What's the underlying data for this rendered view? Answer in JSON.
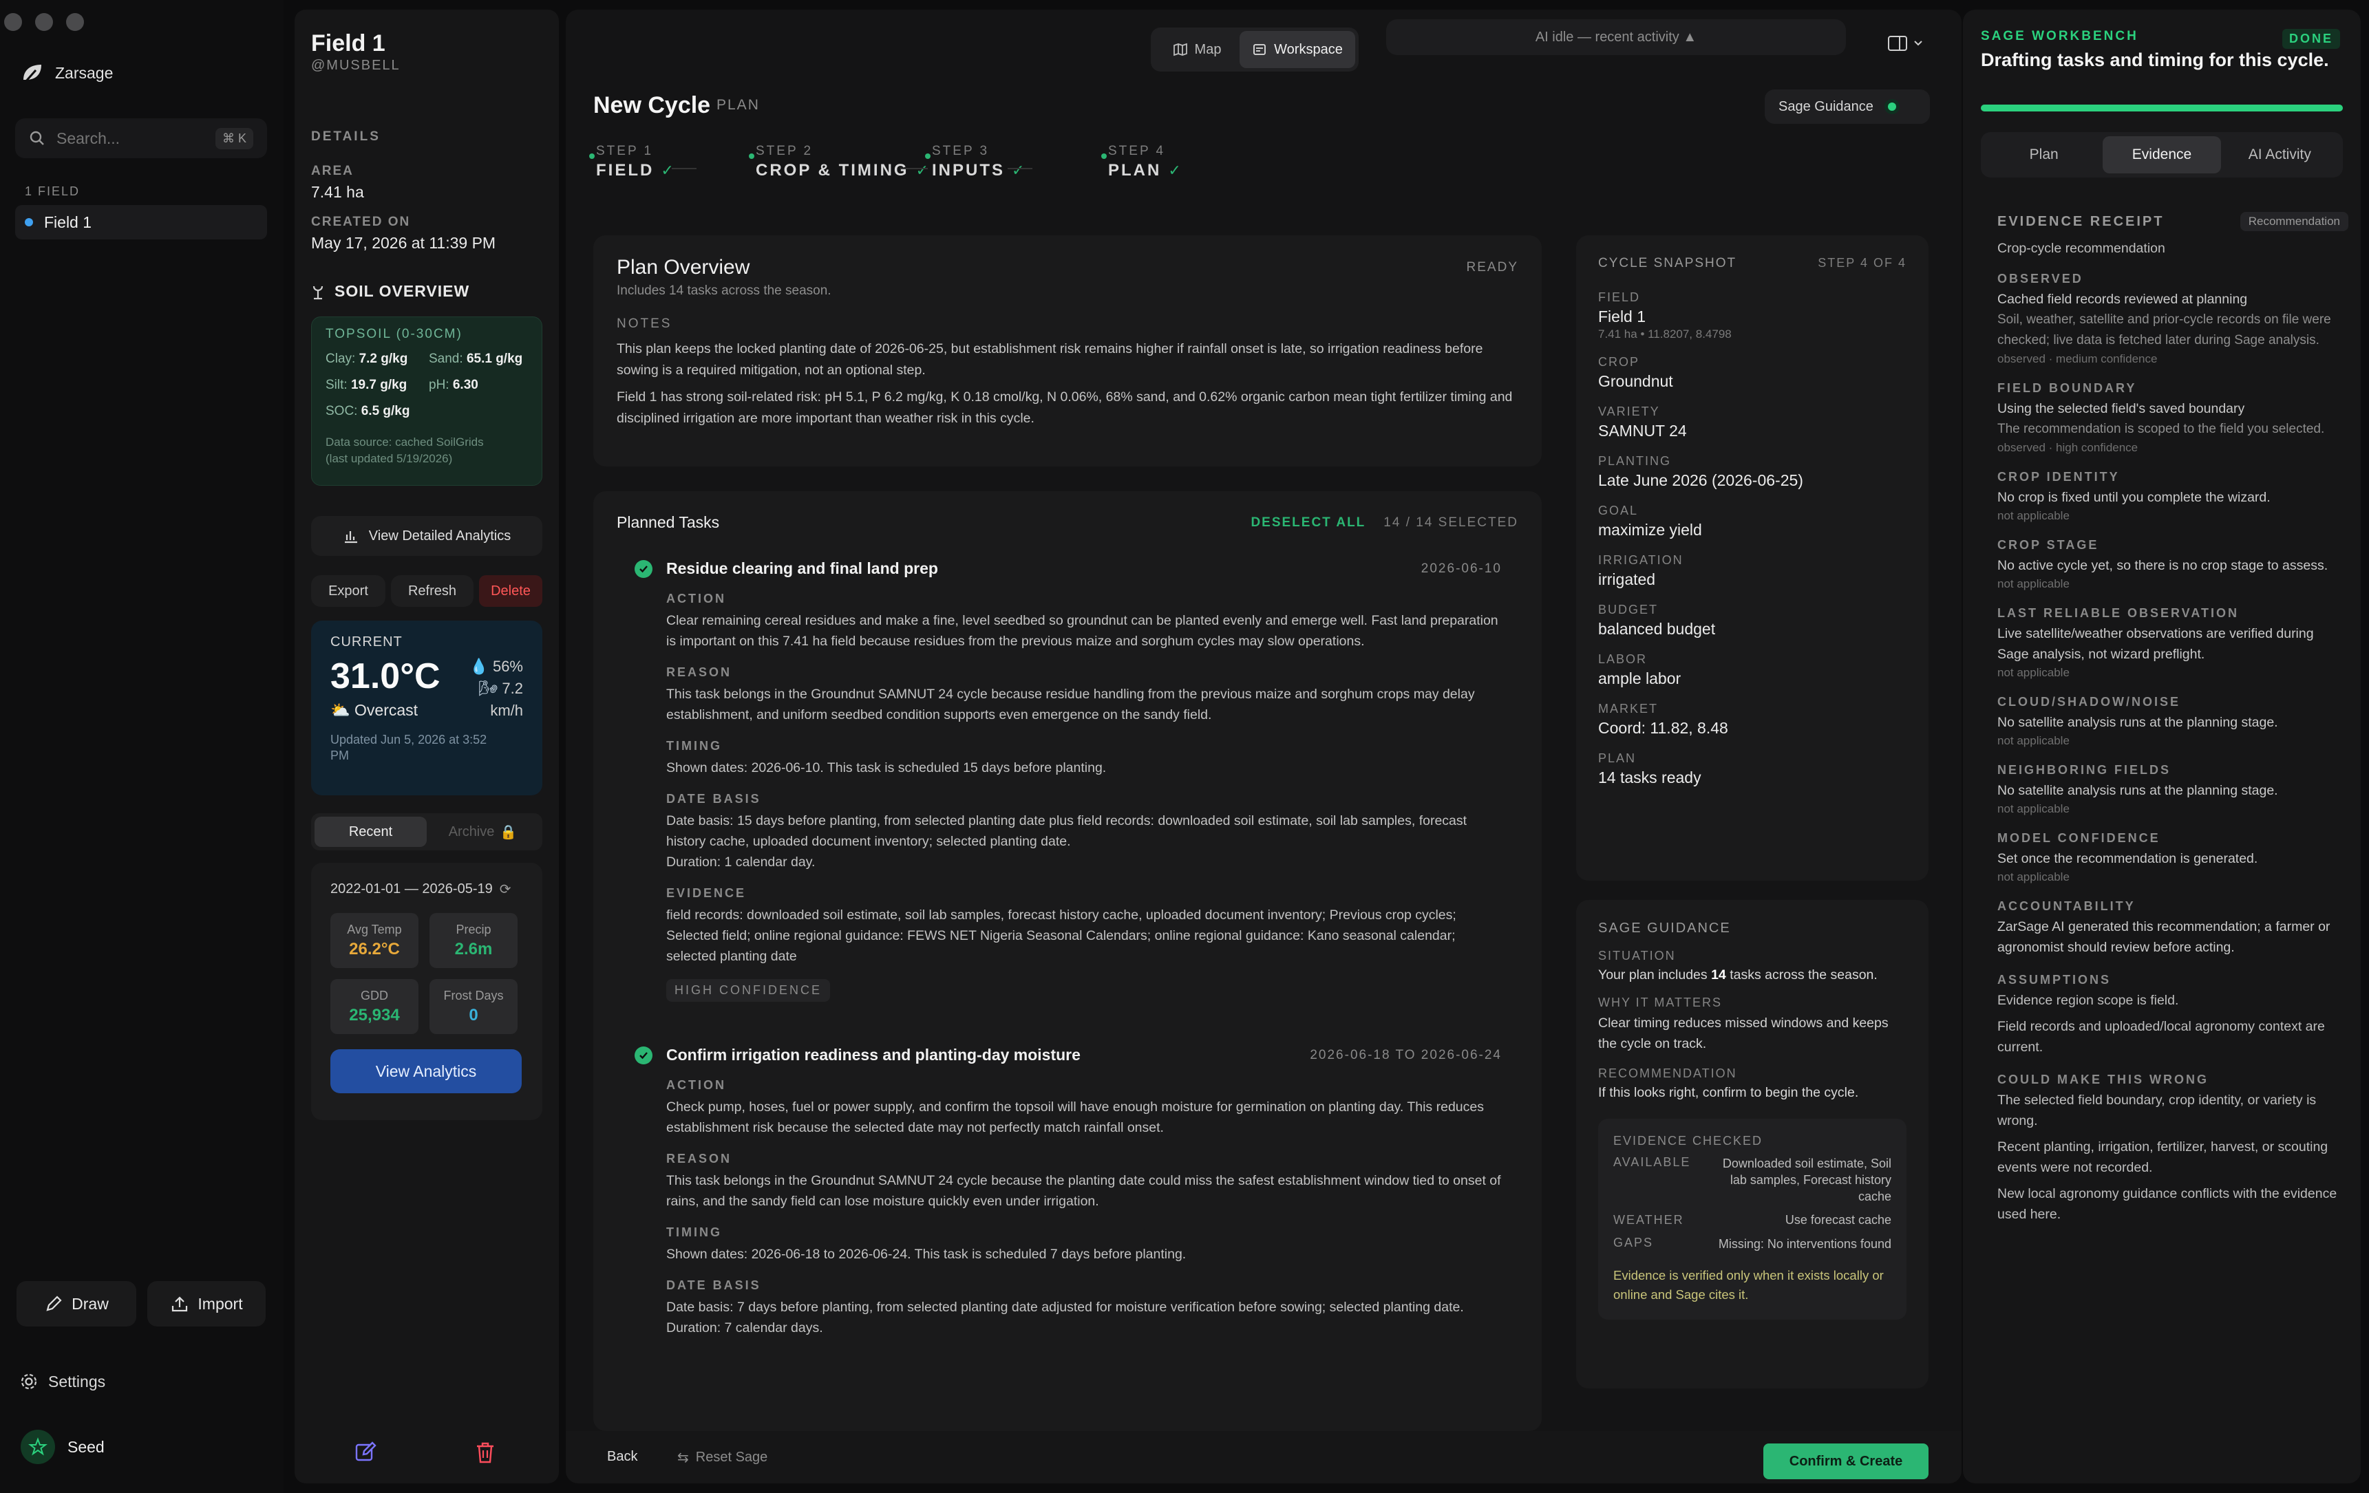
{
  "app": {
    "name": "Zarsage"
  },
  "nav": {
    "search_placeholder": "Search...",
    "shortcut": "⌘ K",
    "section": "1 FIELD",
    "field": "Field 1",
    "draw": "Draw",
    "import": "Import",
    "settings": "Settings",
    "user": "Seed"
  },
  "field": {
    "title": "Field 1",
    "user": "@MUSBELL",
    "details": "DETAILS",
    "area_label": "AREA",
    "area": "7.41 ha",
    "created_label": "CREATED ON",
    "created": "May 17, 2026 at 11:39 PM",
    "soil_title": "SOIL OVERVIEW",
    "topsoil": "TOPSOIL (0-30CM)",
    "clay_k": "Clay:",
    "clay": "7.2 g/kg",
    "sand_k": "Sand:",
    "sand": "65.1 g/kg",
    "silt_k": "Silt:",
    "silt": "19.7 g/kg",
    "ph_k": "pH:",
    "ph": "6.30",
    "soc_k": "SOC:",
    "soc": "6.5 g/kg",
    "source1": "Data source: cached SoilGrids",
    "source2": "(last updated 5/19/2026)",
    "analytics_btn": "View Detailed Analytics",
    "export": "Export",
    "refresh": "Refresh",
    "delete": "Delete",
    "weather": {
      "current": "CURRENT",
      "temp": "31.0°C",
      "humidity": "56%",
      "wind1": "7.2",
      "wind2": "km/h",
      "cond": "Overcast",
      "updated1": "Updated Jun 5, 2026 at 3:52",
      "updated2": "PM"
    },
    "tab_recent": "Recent",
    "tab_archive": "Archive",
    "range": "2022-01-01 — 2026-05-19",
    "stats": [
      {
        "label": "Avg Temp",
        "value": "26.2°C",
        "color": "#e8a93a"
      },
      {
        "label": "Precip",
        "value": "2.6m",
        "color": "#2bb673"
      },
      {
        "label": "GDD",
        "value": "25,934",
        "color": "#2bb673"
      },
      {
        "label": "Frost Days",
        "value": "0",
        "color": "#3ab0d9"
      }
    ],
    "view_analytics": "View Analytics"
  },
  "top": {
    "map": "Map",
    "workspace": "Workspace",
    "status": "AI idle — recent activity ▲"
  },
  "cycle": {
    "title": "New Cycle",
    "tag": "PLAN",
    "guidance": "Sage Guidance",
    "steps": [
      {
        "n": "STEP 1",
        "t": "FIELD"
      },
      {
        "n": "STEP 2",
        "t": "CROP & TIMING"
      },
      {
        "n": "STEP 3",
        "t": "INPUTS"
      },
      {
        "n": "STEP 4",
        "t": "PLAN"
      }
    ]
  },
  "overview": {
    "title": "Plan Overview",
    "status": "READY",
    "sub": "Includes 14 tasks across the season.",
    "notes": "NOTES",
    "p1": "This plan keeps the locked planting date of 2026-06-25, but establishment risk remains higher if rainfall onset is late, so irrigation readiness before sowing is a required mitigation, not an optional step.",
    "p2": "Field 1 has strong soil-related risk: pH 5.1, P 6.2 mg/kg, K 0.18 cmol/kg, N 0.06%, 68% sand, and 0.62% organic carbon mean tight fertilizer timing and disciplined irrigation are more important than weather risk in this cycle."
  },
  "tasks": {
    "title": "Planned Tasks",
    "deselect": "DESELECT ALL",
    "count": "14 / 14 SELECTED",
    "t1": {
      "name": "Residue clearing and final land prep",
      "date": "2026-06-10",
      "action": "Clear remaining cereal residues and make a fine, level seedbed so groundnut can be planted evenly and emerge well. Fast land preparation is important on this 7.41 ha field because residues from the previous maize and sorghum cycles may slow operations.",
      "reason": "This task belongs in the Groundnut SAMNUT 24 cycle because residue handling from the previous maize and sorghum crops may delay establishment, and uniform seedbed condition supports even emergence on the sandy field.",
      "timing": "Shown dates: 2026-06-10. This task is scheduled 15 days before planting.",
      "basis": "Date basis: 15 days before planting, from selected planting date plus field records: downloaded soil estimate, soil lab samples, forecast history cache, uploaded document inventory; selected planting date.",
      "duration": "Duration: 1 calendar day.",
      "evidence": "field records: downloaded soil estimate, soil lab samples, forecast history cache, uploaded document inventory; Previous crop cycles; Selected field; online regional guidance: FEWS NET Nigeria Seasonal Calendars; online regional guidance: Kano seasonal calendar; selected planting date",
      "conf": "HIGH CONFIDENCE"
    },
    "t2": {
      "name": "Confirm irrigation readiness and planting-day moisture",
      "date": "2026-06-18 TO 2026-06-24",
      "action": "Check pump, hoses, fuel or power supply, and confirm the topsoil will have enough moisture for germination on planting day. This reduces establishment risk because the selected date may not perfectly match rainfall onset.",
      "reason": "This task belongs in the Groundnut SAMNUT 24 cycle because the planting date could miss the safest establishment window tied to onset of rains, and the sandy field can lose moisture quickly even under irrigation.",
      "timing": "Shown dates: 2026-06-18 to 2026-06-24. This task is scheduled 7 days before planting.",
      "basis": "Date basis: 7 days before planting, from selected planting date adjusted for moisture verification before sowing; selected planting date.",
      "duration": "Duration: 7 calendar days."
    },
    "labels": {
      "action": "ACTION",
      "reason": "REASON",
      "timing": "TIMING",
      "basis": "DATE BASIS",
      "evidence": "EVIDENCE"
    }
  },
  "snapshot": {
    "title": "CYCLE SNAPSHOT",
    "step": "STEP 4 OF 4",
    "items": [
      {
        "k": "FIELD",
        "v": "Field 1",
        "s": "7.41 ha • 11.8207, 8.4798"
      },
      {
        "k": "CROP",
        "v": "Groundnut"
      },
      {
        "k": "VARIETY",
        "v": "SAMNUT 24"
      },
      {
        "k": "PLANTING",
        "v": "Late June 2026 (2026-06-25)"
      },
      {
        "k": "GOAL",
        "v": "maximize yield"
      },
      {
        "k": "IRRIGATION",
        "v": "irrigated"
      },
      {
        "k": "BUDGET",
        "v": "balanced budget"
      },
      {
        "k": "LABOR",
        "v": "ample labor"
      },
      {
        "k": "MARKET",
        "v": "Coord: 11.82, 8.48"
      },
      {
        "k": "PLAN",
        "v": "14 tasks ready"
      }
    ]
  },
  "sage": {
    "title": "SAGE GUIDANCE",
    "sit_k": "SITUATION",
    "sit_a": "Your plan includes ",
    "sit_b": "14",
    "sit_c": " tasks across the season.",
    "why_k": "WHY IT MATTERS",
    "why": "Clear timing reduces missed windows and keeps the cycle on track.",
    "rec_k": "RECOMMENDATION",
    "rec": "If this looks right, confirm to begin the cycle.",
    "ev_title": "EVIDENCE CHECKED",
    "avail_k": "AVAILABLE",
    "avail_v": "Downloaded soil estimate, Soil lab samples, Forecast history cache",
    "weather_k": "WEATHER",
    "weather_v": "Use forecast cache",
    "gaps_k": "GAPS",
    "gaps_v": "Missing: No interventions found",
    "note": "Evidence is verified only when it exists locally or online and Sage cites it."
  },
  "footer": {
    "back": "Back",
    "reset": "Reset Sage",
    "confirm": "Confirm & Create"
  },
  "workbench": {
    "label": "SAGE WORKBENCH",
    "status": "DONE",
    "title": "Drafting tasks and timing for this cycle.",
    "progress": 1.0,
    "tabs": [
      "Plan",
      "Evidence",
      "AI Activity"
    ],
    "receipt": "EVIDENCE RECEIPT",
    "badge": "Recommendation",
    "receipt_sub": "Crop-cycle recommendation",
    "sections": [
      {
        "k": "OBSERVED",
        "t": "Cached field records reviewed at planning",
        "s": "Soil, weather, satellite and prior-cycle records on file were checked; live data is fetched later during Sage analysis.",
        "n": "observed · medium confidence"
      },
      {
        "k": "FIELD BOUNDARY",
        "t": "Using the selected field's saved boundary",
        "s": "The recommendation is scoped to the field you selected.",
        "n": "observed · high confidence"
      },
      {
        "k": "CROP IDENTITY",
        "t": "No crop is fixed until you complete the wizard.",
        "n": "not applicable"
      },
      {
        "k": "CROP STAGE",
        "t": "No active cycle yet, so there is no crop stage to assess.",
        "n": "not applicable"
      },
      {
        "k": "LAST RELIABLE OBSERVATION",
        "t": "Live satellite/weather observations are verified during Sage analysis, not wizard preflight.",
        "n": "not applicable"
      },
      {
        "k": "CLOUD/SHADOW/NOISE",
        "t": "No satellite analysis runs at the planning stage.",
        "n": "not applicable"
      },
      {
        "k": "NEIGHBORING FIELDS",
        "t": "No satellite analysis runs at the planning stage.",
        "n": "not applicable"
      },
      {
        "k": "MODEL CONFIDENCE",
        "t": "Set once the recommendation is generated.",
        "n": "not applicable"
      },
      {
        "k": "ACCOUNTABILITY",
        "t": "ZarSage AI generated this recommendation; a farmer or agronomist should review before acting."
      }
    ],
    "assumptions": "ASSUMPTIONS",
    "a1": "Evidence region scope is field.",
    "a2": "Field records and uploaded/local agronomy context are current.",
    "wrong": "COULD MAKE THIS WRONG",
    "w1": "The selected field boundary, crop identity, or variety is wrong.",
    "w2": "Recent planting, irrigation, fertilizer, harvest, or scouting events were not recorded.",
    "w3": "New local agronomy guidance conflicts with the evidence used here."
  }
}
